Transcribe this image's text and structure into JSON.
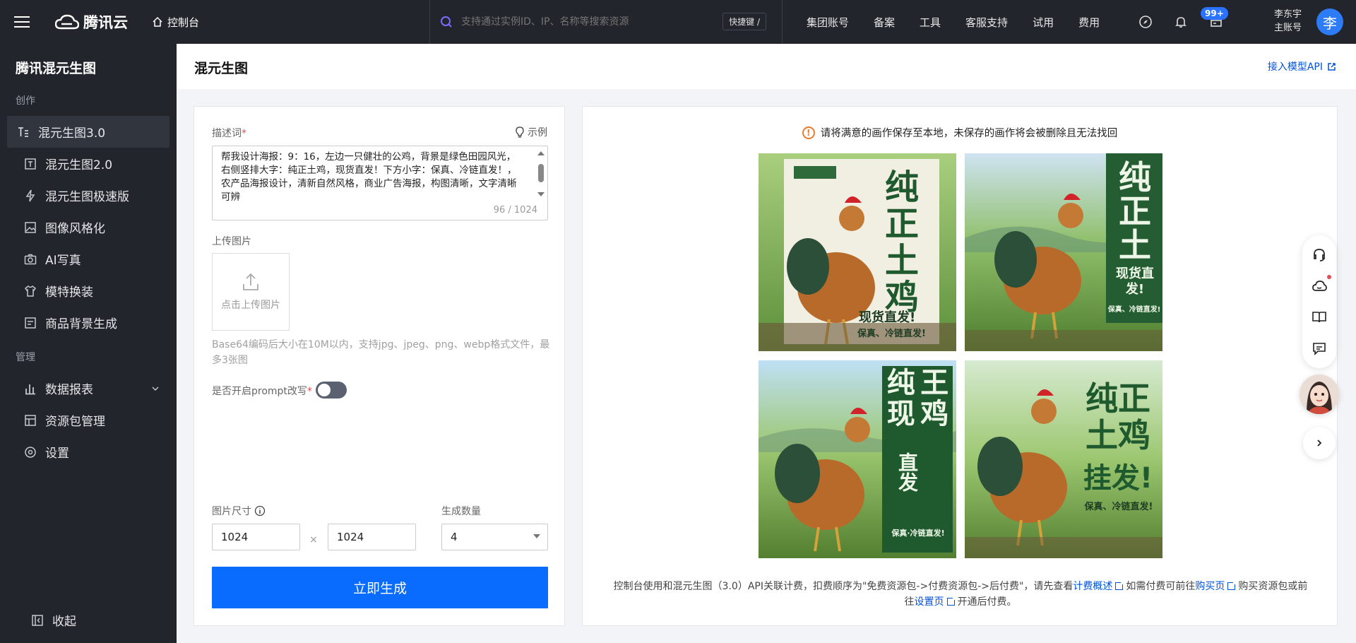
{
  "topbar": {
    "brand": "腾讯云",
    "console": "控制台",
    "search_placeholder": "支持通过实例ID、IP、名称等搜索资源",
    "shortcut": "快捷键 /",
    "nav": [
      "集团账号",
      "备案",
      "工具",
      "客服支持",
      "试用",
      "费用"
    ],
    "badge": "99+",
    "user_name": "李东宇",
    "user_role": "主账号",
    "avatar_letter": "李"
  },
  "sidebar": {
    "title": "腾讯混元生图",
    "section_create": "创作",
    "create_items": [
      {
        "label": "混元生图3.0",
        "icon": "text-image-icon",
        "active": true
      },
      {
        "label": "混元生图2.0",
        "icon": "text-box-icon"
      },
      {
        "label": "混元生图极速版",
        "icon": "lightning-icon"
      },
      {
        "label": "图像风格化",
        "icon": "image-icon"
      },
      {
        "label": "AI写真",
        "icon": "camera-icon"
      },
      {
        "label": "模特换装",
        "icon": "shirt-icon"
      },
      {
        "label": "商品背景生成",
        "icon": "product-image-icon"
      }
    ],
    "section_manage": "管理",
    "manage_items": [
      {
        "label": "数据报表",
        "icon": "bar-chart-icon"
      },
      {
        "label": "资源包管理",
        "icon": "package-icon"
      },
      {
        "label": "设置",
        "icon": "settings-icon"
      }
    ],
    "collapse_label": "收起"
  },
  "header": {
    "title": "混元生图",
    "api_link": "接入模型API"
  },
  "form": {
    "prompt_label": "描述词",
    "required_mark": "*",
    "example_label": "示例",
    "prompt_text": "帮我设计海报：9：16，左边一只健壮的公鸡，背景是绿色田园风光，右侧竖排大字：纯正土鸡，现货直发！下方小字：保真、冷链直发！，农产品海报设计，清新自然风格，商业广告海报，构图清晰，文字清晰可辨",
    "char_count": "96 / 1024",
    "upload_label": "上传图片",
    "upload_button": "点击上传图片",
    "upload_hint": "Base64编码后大小在10M以内，支持jpg、jpeg、png、webp格式文件，最多3张图",
    "rewrite_label": "是否开启prompt改写",
    "rewrite_enabled": false,
    "size_label": "图片尺寸",
    "width": "1024",
    "times": "×",
    "height": "1024",
    "count_label": "生成数量",
    "count_value": "4",
    "generate_button": "立即生成"
  },
  "results": {
    "warning": "请将满意的画作保存至本地，未保存的画作将会被删除且无法找回",
    "images": [
      {
        "alt": "海报：纯正土鸡 现货直发 保真 冷链直发",
        "big": [
          "纯",
          "正",
          "土",
          "鸡"
        ],
        "sub": "现货直发!",
        "small": "保真、冷链直发!"
      },
      {
        "alt": "海报：纯正土鸡 现货直发 保真 冷链直发",
        "big": [
          "纯",
          "正",
          "土"
        ],
        "sub": "现货直发!",
        "small": "保真、冷链直发!"
      },
      {
        "alt": "海报：纯正土鸡 现货直发",
        "big": [
          "纯",
          "王",
          "现",
          "鸡"
        ],
        "sub": "直发",
        "small": "保真·冷链直发!"
      },
      {
        "alt": "海报：纯正土鸡 保真 冷链直发",
        "big": [
          "纯正",
          "土鸡"
        ],
        "sub": "挂发!",
        "small": "保真、冷链直发!"
      }
    ],
    "footer_prefix": "控制台使用和混元生图（3.0）API关联计费，扣费顺序为\"免费资源包->付费资源包->后付费\"，请先查看",
    "footer_link1": "计费概述",
    "footer_mid1": "如需付费可前往",
    "footer_link2": "购买页",
    "footer_mid2": "购买资源包或前往",
    "footer_link3": "设置页",
    "footer_suffix": "开通后付费。"
  },
  "colors": {
    "topbar": "#22252b",
    "accent": "#0a6cff",
    "link": "#0052d9",
    "warning": "#ed7b2f",
    "poster_green": "#1f5a2e"
  }
}
